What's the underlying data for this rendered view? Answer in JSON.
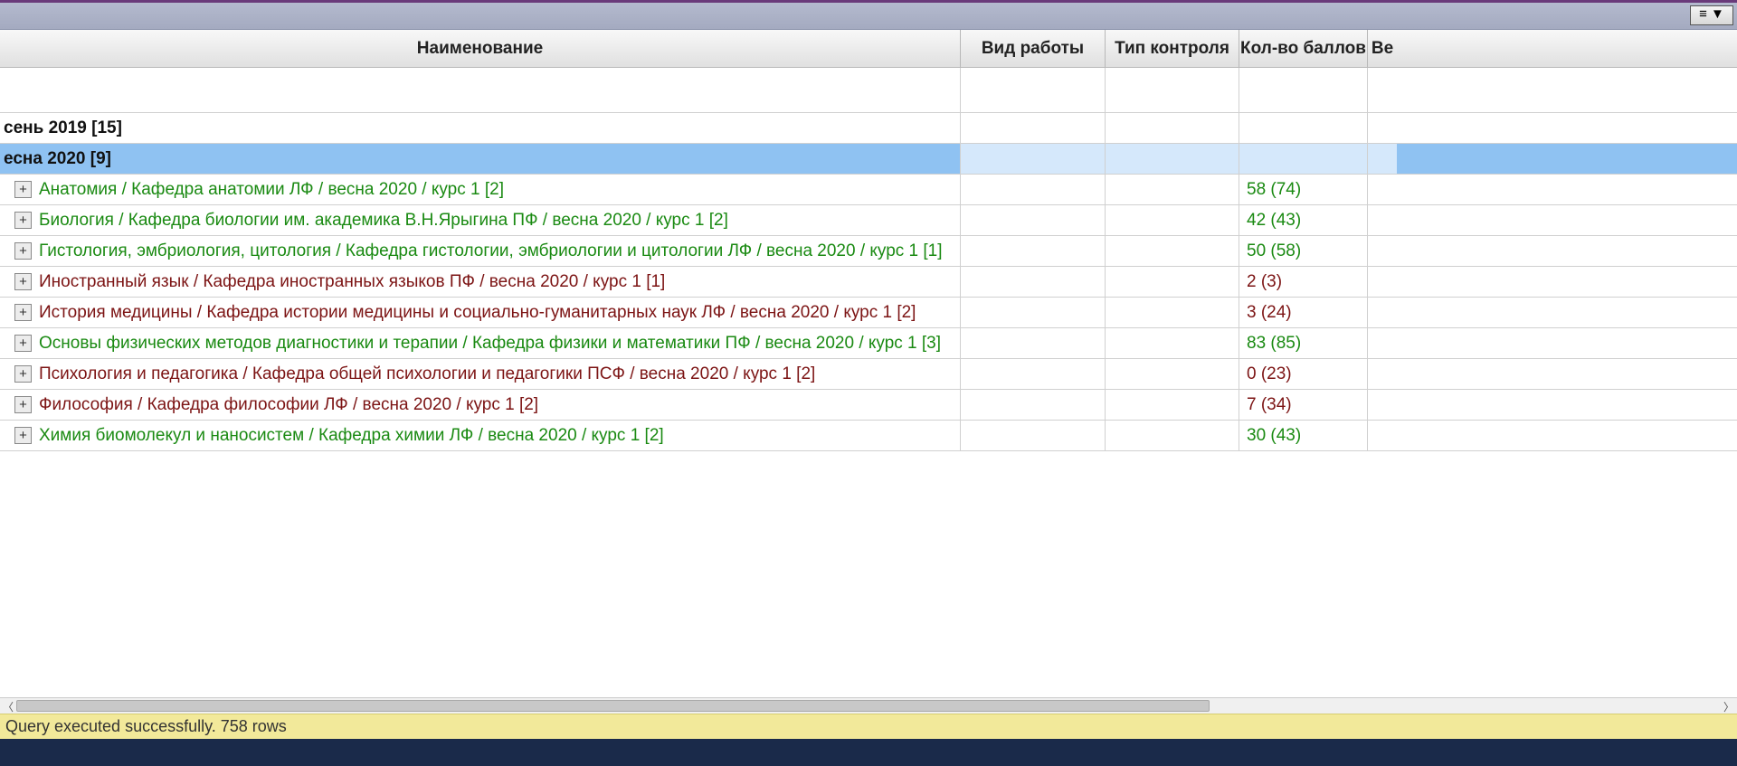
{
  "menu_button_label": "≡ ▼",
  "columns": {
    "name": "Наименование",
    "work": "Вид работы",
    "control": "Тип контроля",
    "score": "Кол-во баллов",
    "weight": "Ве"
  },
  "status": "Query executed successfully. 758 rows",
  "groups": [
    {
      "label": "сень 2019 [15]",
      "selected": false
    },
    {
      "label": "есна 2020 [9]",
      "selected": true
    }
  ],
  "subjects": [
    {
      "name": "Анатомия / Кафедра анатомии ЛФ / весна 2020 / курс 1 [2]",
      "score": "58 (74)",
      "passed": true
    },
    {
      "name": "Биология / Кафедра биологии им. академика В.Н.Ярыгина ПФ / весна 2020 / курс 1 [2]",
      "score": "42 (43)",
      "passed": true
    },
    {
      "name": "Гистология, эмбриология, цитология / Кафедра гистологии, эмбриологии и цитологии ЛФ / весна 2020 / курс 1 [1]",
      "score": "50 (58)",
      "passed": true
    },
    {
      "name": "Иностранный язык / Кафедра иностранных языков ПФ / весна 2020 / курс 1 [1]",
      "score": "2 (3)",
      "passed": false
    },
    {
      "name": "История медицины / Кафедра истории медицины и социально-гуманитарных наук ЛФ / весна 2020 / курс 1 [2]",
      "score": "3 (24)",
      "passed": false
    },
    {
      "name": "Основы физических методов диагностики и терапии / Кафедра физики и математики ПФ / весна 2020 / курс 1 [3]",
      "score": "83 (85)",
      "passed": true
    },
    {
      "name": "Психология и педагогика / Кафедра общей психологии и педагогики ПСФ / весна 2020 / курс 1 [2]",
      "score": "0 (23)",
      "passed": false
    },
    {
      "name": "Философия / Кафедра философии ЛФ / весна 2020 / курс 1 [2]",
      "score": "7 (34)",
      "passed": false
    },
    {
      "name": "Химия биомолекул и наносистем / Кафедра химии ЛФ / весна 2020 / курс 1 [2]",
      "score": "30 (43)",
      "passed": true
    }
  ]
}
